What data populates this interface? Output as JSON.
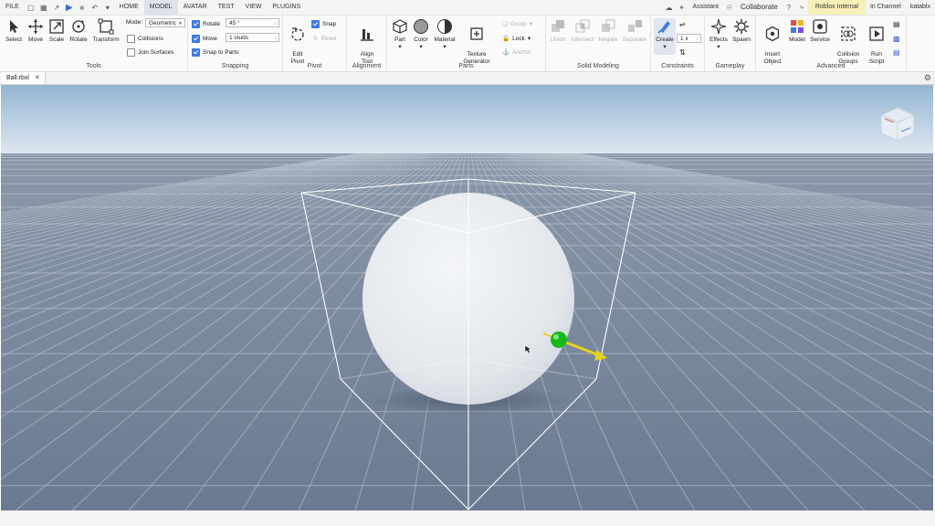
{
  "menu": {
    "file": "FILE",
    "tabs": [
      "HOME",
      "MODEL",
      "AVATAR",
      "TEST",
      "VIEW",
      "PLUGINS"
    ],
    "active_tab": "MODEL",
    "assistant": "Assistant",
    "collaborate": "Collaborate",
    "internal_badge": "Roblox Internal",
    "channel": "In Channel",
    "user": "katablx"
  },
  "tools": {
    "select": "Select",
    "move": "Move",
    "scale": "Scale",
    "rotate": "Rotate",
    "transform": "Transform",
    "mode_label": "Mode:",
    "mode_value": "Geometric",
    "collisions": "Collisions",
    "join_surfaces": "Join Surfaces",
    "group_label": "Tools"
  },
  "snapping": {
    "rotate": "Rotate",
    "rotate_value": "45 °",
    "move": "Move",
    "move_value": "1 studs",
    "snap_to_parts": "Snap to Parts",
    "group_label": "Snapping"
  },
  "pivot": {
    "edit_pivot": "Edit\nPivot",
    "snap": "Snap",
    "reset": "Reset",
    "group_label": "Pivot"
  },
  "alignment": {
    "align_tool": "Align\nTool",
    "group_label": "Alignment"
  },
  "parts": {
    "part": "Part",
    "color": "Color",
    "material": "Material",
    "texture_generator": "Texture\nGenerator",
    "group": "Group",
    "lock": "Lock",
    "anchor": "Anchor",
    "group_label": "Parts"
  },
  "solid_modeling": {
    "union": "Union",
    "intersect": "Intersect",
    "negate": "Negate",
    "separate": "Separate",
    "group_label": "Solid Modeling"
  },
  "constraints": {
    "create": "Create",
    "scale_value": "1 x",
    "group_label": "Constraints"
  },
  "gameplay": {
    "effects": "Effects",
    "spawn": "Spawn",
    "group_label": "Gameplay"
  },
  "advanced": {
    "insert_object": "Insert\nObject",
    "model": "Model",
    "service": "Service",
    "collision_groups": "Collision\nGroups",
    "run_script": "Run\nScript",
    "group_label": "Advanced"
  },
  "document_tab": {
    "name": "Ball.rbxl"
  },
  "colors": {
    "accent": "#3d7be0",
    "sky_top": "#96b6d4",
    "sky_horizon": "#dde7f0",
    "ground": "#6f7f95",
    "sphere": "#e8ecf1",
    "handle_green": "#1fbf1f",
    "handle_yellow": "#e9d81a"
  }
}
